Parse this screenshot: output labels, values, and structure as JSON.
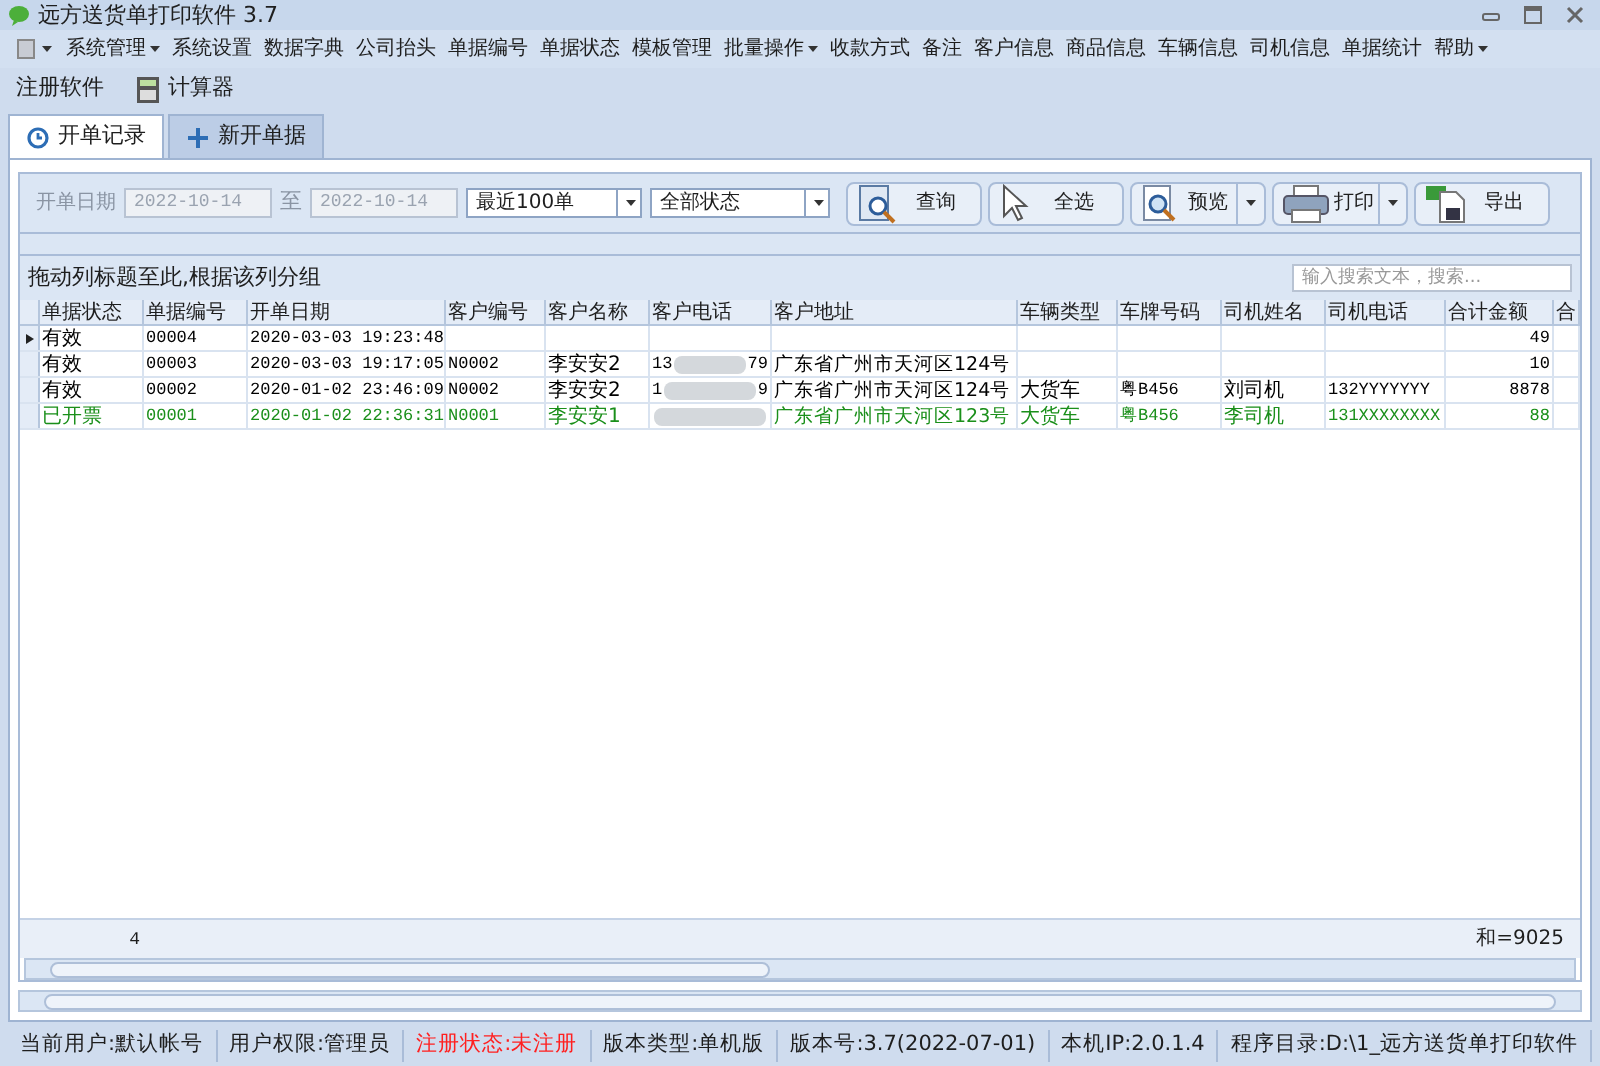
{
  "window": {
    "title": "远方送货单打印软件 3.7"
  },
  "menu": [
    {
      "label": "系统管理",
      "dropdown": true
    },
    {
      "label": "系统设置",
      "dropdown": false
    },
    {
      "label": "数据字典",
      "dropdown": false
    },
    {
      "label": "公司抬头",
      "dropdown": false
    },
    {
      "label": "单据编号",
      "dropdown": false
    },
    {
      "label": "单据状态",
      "dropdown": false
    },
    {
      "label": "模板管理",
      "dropdown": false
    },
    {
      "label": "批量操作",
      "dropdown": true
    },
    {
      "label": "收款方式",
      "dropdown": false
    },
    {
      "label": "备注",
      "dropdown": false
    },
    {
      "label": "客户信息",
      "dropdown": false
    },
    {
      "label": "商品信息",
      "dropdown": false
    },
    {
      "label": "车辆信息",
      "dropdown": false
    },
    {
      "label": "司机信息",
      "dropdown": false
    },
    {
      "label": "单据统计",
      "dropdown": false
    },
    {
      "label": "帮助",
      "dropdown": true
    }
  ],
  "toolbar": [
    {
      "label": "注册软件",
      "kind": "text"
    },
    {
      "label": "计算器",
      "kind": "calculator"
    }
  ],
  "tabs": [
    {
      "label": "开单记录",
      "kind": "history",
      "selected": true
    },
    {
      "label": "新开单据",
      "kind": "add",
      "selected": false
    }
  ],
  "filter": {
    "date_label": "开单日期",
    "date_from": "2022-10-14",
    "to_label": "至",
    "date_to": "2022-10-14",
    "range": "最近100单",
    "status": "全部状态",
    "disabled": true
  },
  "actions": [
    {
      "label": "查询",
      "kind": "search",
      "split": false
    },
    {
      "label": "全选",
      "kind": "pointer",
      "split": false
    },
    {
      "label": "预览",
      "kind": "preview",
      "split": true
    },
    {
      "label": "打印",
      "kind": "print",
      "split": true
    },
    {
      "label": "导出",
      "kind": "export",
      "split": false
    }
  ],
  "group_hint": "拖动列标题至此,根据该列分组",
  "search": {
    "placeholder": "输入搜索文本，搜索..."
  },
  "table": {
    "columns": [
      "单据状态",
      "单据编号",
      "开单日期",
      "客户编号",
      "客户名称",
      "客户电话",
      "客户地址",
      "车辆类型",
      "车牌号码",
      "司机姓名",
      "司机电话",
      "合计金额",
      "合"
    ],
    "rows": [
      {
        "current": true,
        "color": "#000000",
        "cells": [
          "有效",
          "00004",
          "2020-03-03 19:23:48",
          "",
          "",
          "",
          "",
          "",
          "",
          "",
          "",
          "49",
          ""
        ],
        "phone_blurred": false,
        "phone_end": ""
      },
      {
        "current": false,
        "color": "#000000",
        "cells": [
          "有效",
          "00003",
          "2020-03-03 19:17:05",
          "N0002",
          "李安安2",
          "13",
          "广东省广州市天河区124号",
          "",
          "",
          "",
          "",
          "10",
          ""
        ],
        "phone_blurred": true,
        "phone_end": "79"
      },
      {
        "current": false,
        "color": "#000000",
        "cells": [
          "有效",
          "00002",
          "2020-01-02 23:46:09",
          "N0002",
          "李安安2",
          "1",
          "广东省广州市天河区124号",
          "大货车",
          "粤B456",
          "刘司机",
          "132YYYYYYY",
          "8878",
          ""
        ],
        "phone_blurred": true,
        "phone_end": "9"
      },
      {
        "current": false,
        "color": "#1a8f1a",
        "cells": [
          "已开票",
          "00001",
          "2020-01-02 22:36:31",
          "N0001",
          "李安安1",
          "",
          "广东省广州市天河区123号",
          "大货车",
          "粤B456",
          "李司机",
          "131XXXXXXXX",
          "88",
          ""
        ],
        "phone_blurred": true,
        "phone_end": ""
      }
    ],
    "footer_count": "4",
    "footer_sum": "和=9025"
  },
  "status_bar": [
    {
      "text": "当前用户:默认帐号",
      "alert": false
    },
    {
      "text": "用户权限:管理员",
      "alert": false
    },
    {
      "text": "注册状态:未注册",
      "alert": true
    },
    {
      "text": "版本类型:单机版",
      "alert": false
    },
    {
      "text": "版本号:3.7(2022-07-01)",
      "alert": false
    },
    {
      "text": "本机IP:2.0.1.4",
      "alert": false
    },
    {
      "text": "程序目录:D:\\1_远方送货单打印软件",
      "alert": false
    }
  ]
}
